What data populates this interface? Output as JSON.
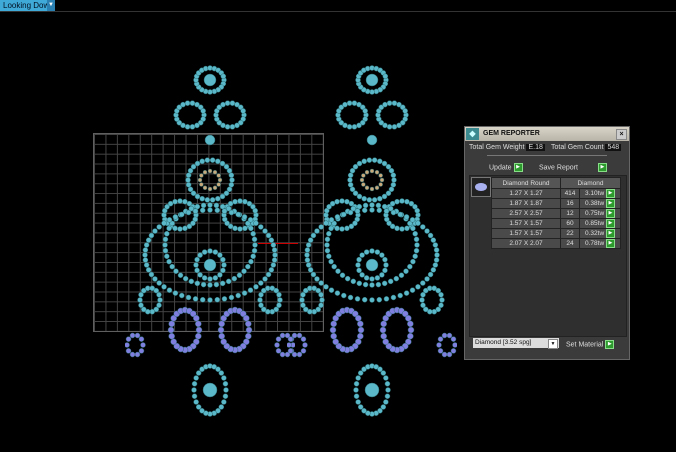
{
  "toolbar": {
    "view_mode": "Looking Down"
  },
  "panel": {
    "title": "GEM REPORTER",
    "total_weight_label": "Total Gem Weight",
    "total_weight": "E.18",
    "total_count_label": "Total Gem Count",
    "total_count": "548",
    "update_label": "Update",
    "save_label": "Save Report",
    "headers": [
      "Diamond Round",
      "Diamond"
    ],
    "rows": [
      {
        "size": "1.27 X 1.27",
        "count": "414",
        "weight": "3.10tw"
      },
      {
        "size": "1.87 X 1.87",
        "count": "16",
        "weight": "0.38tw"
      },
      {
        "size": "2.57 X 2.57",
        "count": "12",
        "weight": "0.75tw"
      },
      {
        "size": "1.57 X 1.57",
        "count": "60",
        "weight": "0.85tw"
      },
      {
        "size": "1.57 X 1.57",
        "count": "22",
        "weight": "0.32tw"
      },
      {
        "size": "2.07 X 2.07",
        "count": "24",
        "weight": "0.78tw"
      }
    ],
    "material": "Diamond    [3.52 spg]",
    "set_material_label": "Set Material"
  },
  "colors": {
    "gem": "#5ab8c8",
    "metal": "#5fae3a",
    "drop": "#7f7fe0",
    "accent": "#3fa9d8"
  }
}
